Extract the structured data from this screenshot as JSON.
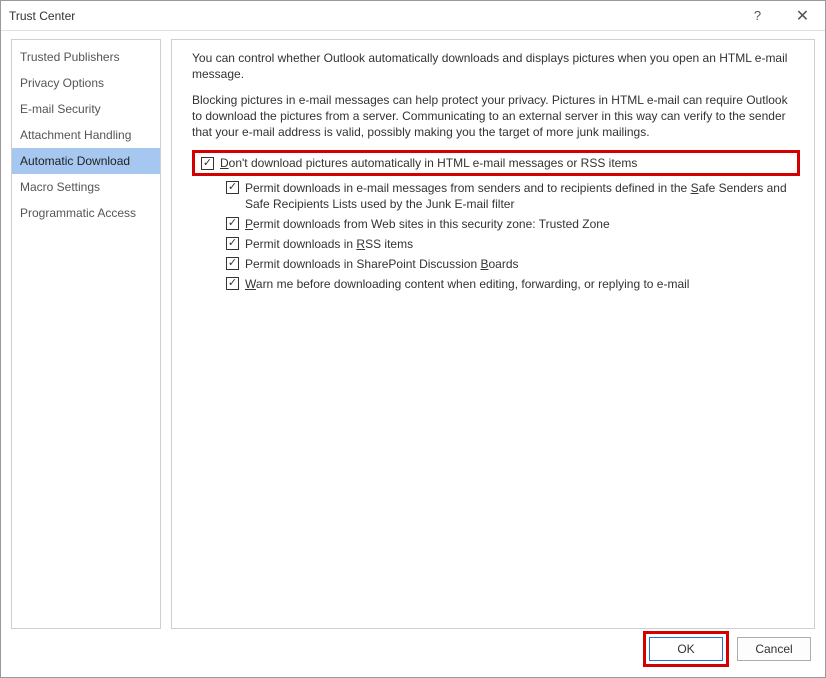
{
  "window": {
    "title": "Trust Center"
  },
  "sidebar": {
    "items": [
      {
        "label": "Trusted Publishers"
      },
      {
        "label": "Privacy Options"
      },
      {
        "label": "E-mail Security"
      },
      {
        "label": "Attachment Handling"
      },
      {
        "label": "Automatic Download"
      },
      {
        "label": "Macro Settings"
      },
      {
        "label": "Programmatic Access"
      }
    ],
    "selected_index": 4
  },
  "content": {
    "para1": "You can control whether Outlook automatically downloads and displays pictures when you open an HTML e-mail message.",
    "para2": "Blocking pictures in e-mail messages can help protect your privacy. Pictures in HTML e-mail can require Outlook to download the pictures from a server. Communicating to an external server in this way can verify to the sender that your e-mail address is valid, possibly making you the target of more junk mailings.",
    "options": {
      "main": {
        "checked": true,
        "pre": "",
        "accel": "D",
        "post": "on't download pictures automatically in HTML e-mail messages or RSS items"
      },
      "sub": [
        {
          "checked": true,
          "pre": "Permit downloads in e-mail messages from senders and to recipients defined in the ",
          "accel": "S",
          "post": "afe Senders and Safe Recipients Lists used by the Junk E-mail filter"
        },
        {
          "checked": true,
          "pre": "",
          "accel": "P",
          "post": "ermit downloads from Web sites in this security zone: Trusted Zone"
        },
        {
          "checked": true,
          "pre": "Permit downloads in ",
          "accel": "R",
          "post": "SS items"
        },
        {
          "checked": true,
          "pre": "Permit downloads in SharePoint Discussion ",
          "accel": "B",
          "post": "oards"
        },
        {
          "checked": true,
          "pre": "",
          "accel": "W",
          "post": "arn me before downloading content when editing, forwarding, or replying to e-mail"
        }
      ]
    }
  },
  "footer": {
    "ok": "OK",
    "cancel": "Cancel"
  }
}
